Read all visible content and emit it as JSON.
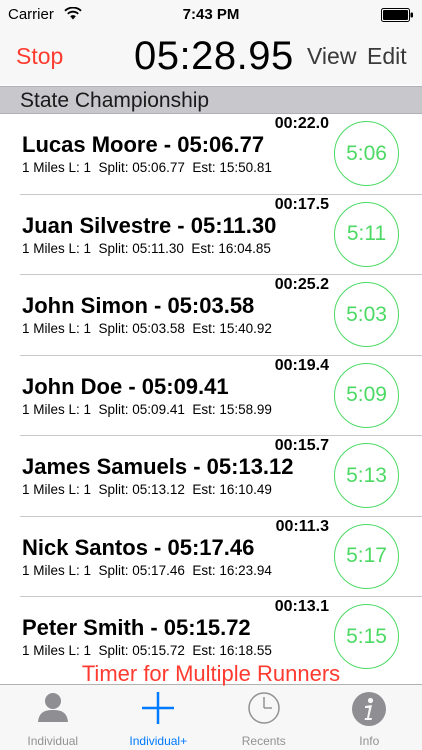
{
  "status_bar": {
    "carrier": "Carrier",
    "time": "7:43 PM"
  },
  "nav": {
    "stop_label": "Stop",
    "timer": "05:28.95",
    "view_label": "View",
    "edit_label": "Edit"
  },
  "section": {
    "title": "State Championship"
  },
  "runners": [
    {
      "elapsed": "00:22.0",
      "name": "Lucas Moore - 05:06.77",
      "detail": "1 Miles L: 1  Split: 05:06.77  Est: 15:50.81",
      "lap": "5:06"
    },
    {
      "elapsed": "00:17.5",
      "name": "Juan Silvestre - 05:11.30",
      "detail": "1 Miles L: 1  Split: 05:11.30  Est: 16:04.85",
      "lap": "5:11"
    },
    {
      "elapsed": "00:25.2",
      "name": "John Simon - 05:03.58",
      "detail": "1 Miles L: 1  Split: 05:03.58  Est: 15:40.92",
      "lap": "5:03"
    },
    {
      "elapsed": "00:19.4",
      "name": "John Doe - 05:09.41",
      "detail": "1 Miles L: 1  Split: 05:09.41  Est: 15:58.99",
      "lap": "5:09"
    },
    {
      "elapsed": "00:15.7",
      "name": "James Samuels - 05:13.12",
      "detail": "1 Miles L: 1  Split: 05:13.12  Est: 16:10.49",
      "lap": "5:13"
    },
    {
      "elapsed": "00:11.3",
      "name": "Nick Santos - 05:17.46",
      "detail": "1 Miles L: 1  Split: 05:17.46  Est: 16:23.94",
      "lap": "5:17"
    },
    {
      "elapsed": "00:13.1",
      "name": "Peter Smith - 05:15.72",
      "detail": "1 Miles L: 1  Split: 05:15.72  Est: 16:18.55",
      "lap": "5:15"
    }
  ],
  "promo": "Timer for Multiple Runners",
  "tabs": [
    {
      "label": "Individual",
      "icon": "person-icon",
      "active": false
    },
    {
      "label": "Individual+",
      "icon": "plus-icon",
      "active": true
    },
    {
      "label": "Recents",
      "icon": "clock-icon",
      "active": false
    },
    {
      "label": "Info",
      "icon": "info-icon",
      "active": false
    }
  ],
  "colors": {
    "accent": "#007aff",
    "stop": "#ff3b30",
    "lap_circle": "#4cd964",
    "section_bg": "#c7c7cc"
  }
}
